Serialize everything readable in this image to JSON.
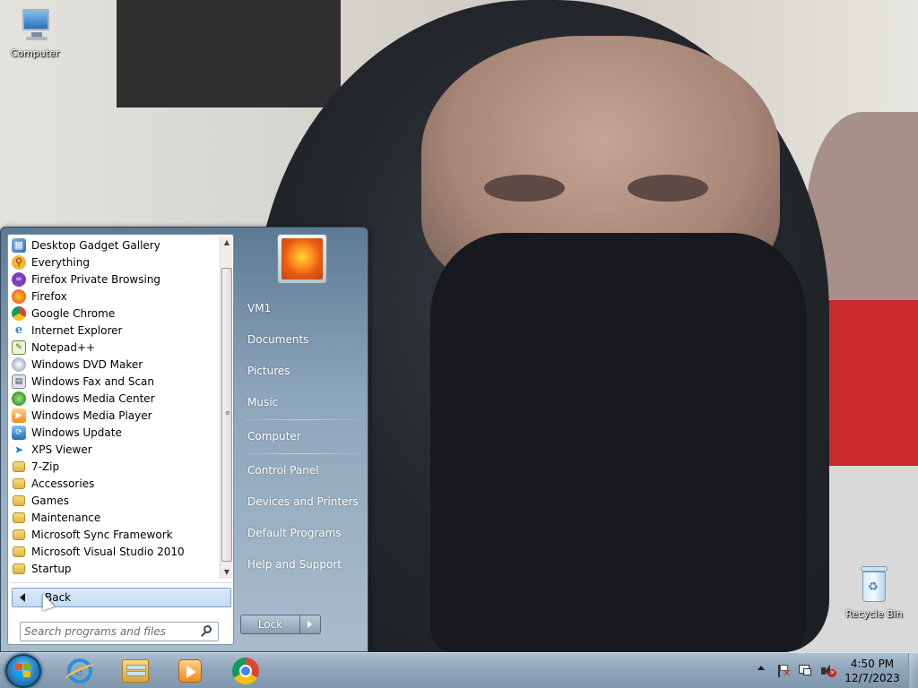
{
  "desktop": {
    "icons": [
      {
        "label": "Computer"
      },
      {
        "label": "Recycle Bin"
      }
    ]
  },
  "start_menu": {
    "programs": [
      {
        "label": "Desktop Gadget Gallery",
        "icon": "gadget-icon"
      },
      {
        "label": "Everything",
        "icon": "everything-search-icon"
      },
      {
        "label": "Firefox Private Browsing",
        "icon": "firefox-private-icon"
      },
      {
        "label": "Firefox",
        "icon": "firefox-icon"
      },
      {
        "label": "Google Chrome",
        "icon": "chrome-icon"
      },
      {
        "label": "Internet Explorer",
        "icon": "internet-explorer-icon"
      },
      {
        "label": "Notepad++",
        "icon": "notepad-plus-plus-icon"
      },
      {
        "label": "Windows DVD Maker",
        "icon": "dvd-maker-icon"
      },
      {
        "label": "Windows Fax and Scan",
        "icon": "fax-scan-icon"
      },
      {
        "label": "Windows Media Center",
        "icon": "media-center-icon"
      },
      {
        "label": "Windows Media Player",
        "icon": "media-player-icon"
      },
      {
        "label": "Windows Update",
        "icon": "windows-update-icon"
      },
      {
        "label": "XPS Viewer",
        "icon": "xps-viewer-icon"
      },
      {
        "label": "7-Zip",
        "icon": "folder-icon"
      },
      {
        "label": "Accessories",
        "icon": "folder-icon"
      },
      {
        "label": "Games",
        "icon": "folder-icon"
      },
      {
        "label": "Maintenance",
        "icon": "folder-icon"
      },
      {
        "label": "Microsoft Sync Framework",
        "icon": "folder-icon"
      },
      {
        "label": "Microsoft Visual Studio 2010",
        "icon": "folder-icon"
      },
      {
        "label": "Startup",
        "icon": "folder-icon"
      }
    ],
    "back_label": "Back",
    "search_placeholder": "Search programs and files",
    "right_links": {
      "user": "VM1",
      "documents": "Documents",
      "pictures": "Pictures",
      "music": "Music",
      "computer": "Computer",
      "control_panel": "Control Panel",
      "devices_printers": "Devices and Printers",
      "default_programs": "Default Programs",
      "help_support": "Help and Support"
    },
    "lock_label": "Lock"
  },
  "taskbar": {
    "pinned": [
      "internet-explorer-icon",
      "windows-explorer-icon",
      "windows-media-player-icon",
      "chrome-icon"
    ],
    "clock": {
      "time": "4:50 PM",
      "date": "12/7/2023"
    }
  },
  "colors": {
    "start_menu_bg": "#8ea6bb",
    "back_highlight": "#c3dcf3",
    "taskbar_bg": "#8fa5ba"
  }
}
